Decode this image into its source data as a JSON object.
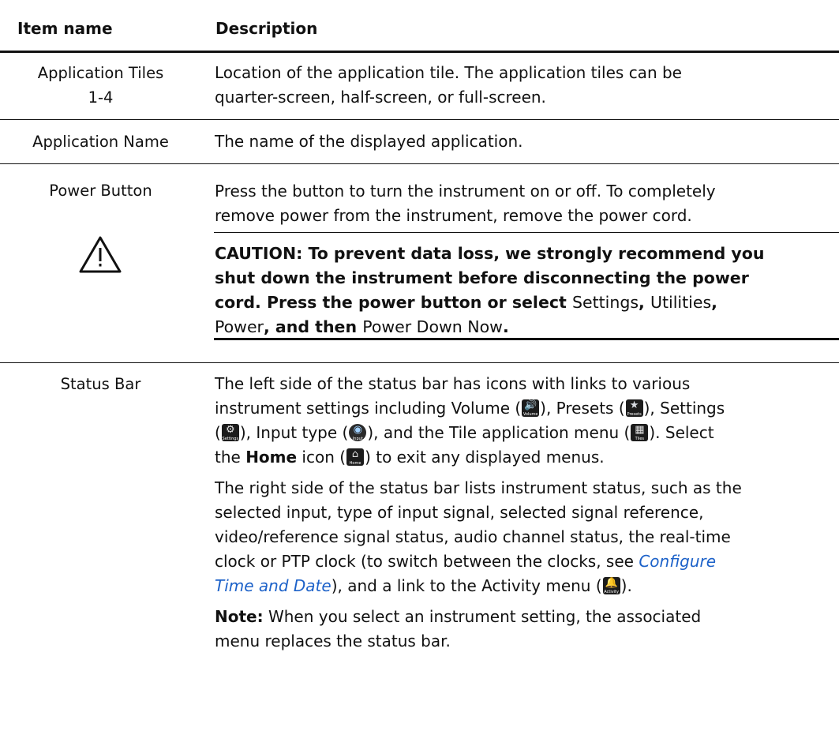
{
  "table": {
    "headers": {
      "item_name": "Item name",
      "description": "Description"
    },
    "rows": {
      "tiles": {
        "name_line1": "Application Tiles",
        "name_line2": "1-4",
        "desc_line1": "Location of the application tile. The application tiles can be",
        "desc_line2": "quarter-screen, half-screen, or full-screen."
      },
      "app_name": {
        "name": "Application Name",
        "desc": "The name of the displayed application."
      },
      "power": {
        "name": "Power Button",
        "desc_line1": "Press the button to turn the instrument on or off. To completely",
        "desc_line2": "remove power from the instrument, remove the power cord.",
        "caution": {
          "line1": "CAUTION:  To prevent data loss, we strongly recommend you",
          "line2": "shut down the instrument before disconnecting the power",
          "line3_a": "cord. Press the power button or select ",
          "settings": "Settings",
          "comma1": ", ",
          "utilities": "Utilities",
          "comma2": ",",
          "power": "Power",
          "and_then": ", and then ",
          "power_down_now": "Power Down Now",
          "period": "."
        }
      },
      "status_bar": {
        "name": "Status Bar",
        "p1_line1": "The left side of the status bar has icons with links to various",
        "p1_line2_a": "instrument settings including Volume (",
        "p1_line2_b": "), Presets (",
        "p1_line2_c": "), Settings",
        "p1_line3_a": "(",
        "p1_line3_b": "), Input type (",
        "p1_line3_c": "), and the Tile application menu (",
        "p1_line3_d": "). Select",
        "p1_line4_a": "the ",
        "p1_line4_home": "Home",
        "p1_line4_b": " icon (",
        "p1_line4_c": ") to exit any displayed menus.",
        "p2_line1": "The right side of the status bar lists instrument status, such as the",
        "p2_line2": "selected input, type of input signal, selected signal reference,",
        "p2_line3": "video/reference signal status, audio channel status, the real-time",
        "p2_line4_a": "clock or PTP clock (to switch between the clocks, see ",
        "p2_link_a": "Configure",
        "p2_link_b": "Time and Date",
        "p2_line5_b": "), and a link to the Activity menu (",
        "p2_line5_c": ").",
        "note_label": "Note:",
        "note_line1": " When you select an instrument setting, the associated",
        "note_line2": "menu replaces the status bar."
      }
    }
  },
  "icons": {
    "volume": {
      "icon": "speaker-icon",
      "label": "Volume"
    },
    "presets": {
      "icon": "star-icon",
      "label": "Presets"
    },
    "settings": {
      "icon": "gear-icon",
      "label": "Settings"
    },
    "input": {
      "icon": "input-dial-icon",
      "label": "Input"
    },
    "tiles": {
      "icon": "grid-icon",
      "label": "Tiles"
    },
    "home": {
      "icon": "home-icon",
      "label": "Home"
    },
    "activity": {
      "icon": "bell-icon",
      "label": "Activity"
    }
  },
  "colors": {
    "link": "#1d62c9",
    "rule": "#111111",
    "icon_bg": "#1c1c1c"
  }
}
